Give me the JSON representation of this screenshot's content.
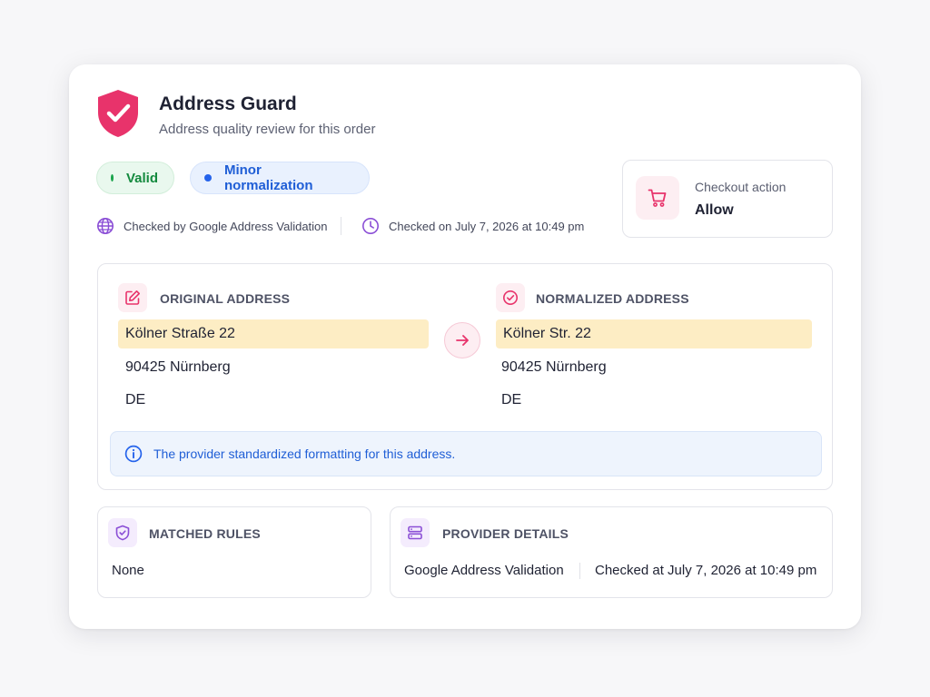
{
  "header": {
    "title": "Address Guard",
    "subtitle": "Address quality review for this order",
    "icon": "shield-check-icon"
  },
  "status": {
    "valid_label": "Valid",
    "normalization_label": "Minor normalization"
  },
  "meta": {
    "provider_text": "Checked by Google Address Validation",
    "time_text": "Checked on July 7, 2026 at 10:49 pm"
  },
  "checkout": {
    "label": "Checkout action",
    "value": "Allow",
    "icon": "cart-icon"
  },
  "original": {
    "title": "ORIGINAL ADDRESS",
    "line1": "Kölner Straße 22",
    "line2": "90425 Nürnberg",
    "line3": "DE"
  },
  "normalized": {
    "title": "NORMALIZED ADDRESS",
    "line1": "Kölner Str. 22",
    "line2": "90425 Nürnberg",
    "line3": "DE"
  },
  "info": {
    "text": "The provider standardized formatting for this address."
  },
  "rules": {
    "title": "MATCHED RULES",
    "value": "None"
  },
  "provider": {
    "title": "PROVIDER DETAILS",
    "name": "Google Address Validation",
    "checked_at": "Checked at July 7, 2026 at 10:49 pm"
  },
  "colors": {
    "brand": "#e8336b",
    "valid": "#18a34a",
    "info": "#2563eb",
    "highlight": "#fdedc4",
    "purple": "#8b4fd6"
  }
}
